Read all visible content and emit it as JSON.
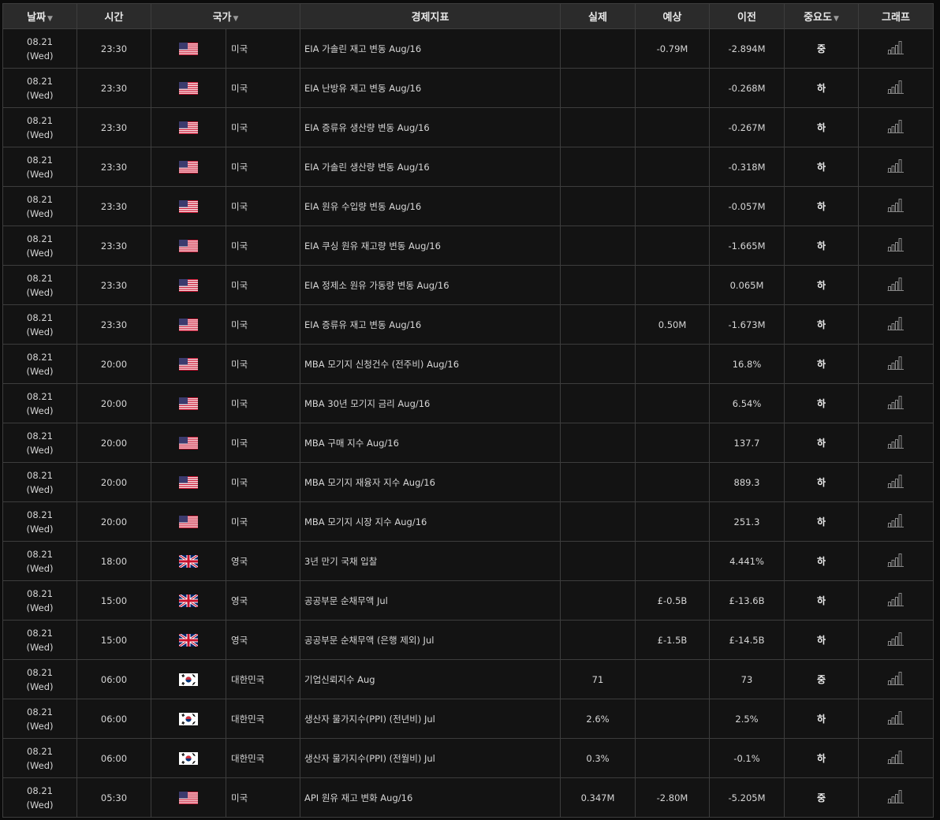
{
  "headers": {
    "date": "날짜",
    "time": "시간",
    "country": "국가",
    "indicator": "경제지표",
    "actual": "실제",
    "forecast": "예상",
    "previous": "이전",
    "importance": "중요도",
    "graph": "그래프",
    "sort_arrow": "▼"
  },
  "icons": {
    "sort": "triangle-down-icon",
    "graph": "bar-chart-icon",
    "flags": {
      "US": "us-flag-icon",
      "UK": "uk-flag-icon",
      "KR": "kr-flag-icon"
    }
  },
  "colors": {
    "background": "#0c0c0c",
    "header_bg": "#2b2b2b",
    "row_bg": "#131313",
    "border": "#3d3d3d"
  },
  "rows": [
    {
      "date": "08.21",
      "day": "(Wed)",
      "time": "23:30",
      "flag": "US",
      "country": "미국",
      "indicator": "EIA 가솔린 재고 변동 Aug/16",
      "actual": "",
      "forecast": "-0.79M",
      "previous": "-2.894M",
      "importance": "중"
    },
    {
      "date": "08.21",
      "day": "(Wed)",
      "time": "23:30",
      "flag": "US",
      "country": "미국",
      "indicator": "EIA 난방유 재고 변동 Aug/16",
      "actual": "",
      "forecast": "",
      "previous": "-0.268M",
      "importance": "하"
    },
    {
      "date": "08.21",
      "day": "(Wed)",
      "time": "23:30",
      "flag": "US",
      "country": "미국",
      "indicator": "EIA 증류유 생산량 변동 Aug/16",
      "actual": "",
      "forecast": "",
      "previous": "-0.267M",
      "importance": "하"
    },
    {
      "date": "08.21",
      "day": "(Wed)",
      "time": "23:30",
      "flag": "US",
      "country": "미국",
      "indicator": "EIA 가솔린 생산량 변동 Aug/16",
      "actual": "",
      "forecast": "",
      "previous": "-0.318M",
      "importance": "하"
    },
    {
      "date": "08.21",
      "day": "(Wed)",
      "time": "23:30",
      "flag": "US",
      "country": "미국",
      "indicator": "EIA 원유 수입량 변동 Aug/16",
      "actual": "",
      "forecast": "",
      "previous": "-0.057M",
      "importance": "하"
    },
    {
      "date": "08.21",
      "day": "(Wed)",
      "time": "23:30",
      "flag": "US",
      "country": "미국",
      "indicator": "EIA 쿠싱 원유 재고량 변동 Aug/16",
      "actual": "",
      "forecast": "",
      "previous": "-1.665M",
      "importance": "하"
    },
    {
      "date": "08.21",
      "day": "(Wed)",
      "time": "23:30",
      "flag": "US",
      "country": "미국",
      "indicator": "EIA 정제소 원유 가동량 변동 Aug/16",
      "actual": "",
      "forecast": "",
      "previous": "0.065M",
      "importance": "하"
    },
    {
      "date": "08.21",
      "day": "(Wed)",
      "time": "23:30",
      "flag": "US",
      "country": "미국",
      "indicator": "EIA 증류유 재고 변동 Aug/16",
      "actual": "",
      "forecast": "0.50M",
      "previous": "-1.673M",
      "importance": "하"
    },
    {
      "date": "08.21",
      "day": "(Wed)",
      "time": "20:00",
      "flag": "US",
      "country": "미국",
      "indicator": "MBA 모기지 신청건수 (전주비) Aug/16",
      "actual": "",
      "forecast": "",
      "previous": "16.8%",
      "importance": "하"
    },
    {
      "date": "08.21",
      "day": "(Wed)",
      "time": "20:00",
      "flag": "US",
      "country": "미국",
      "indicator": "MBA 30년 모기지 금리 Aug/16",
      "actual": "",
      "forecast": "",
      "previous": "6.54%",
      "importance": "하"
    },
    {
      "date": "08.21",
      "day": "(Wed)",
      "time": "20:00",
      "flag": "US",
      "country": "미국",
      "indicator": "MBA 구매 지수 Aug/16",
      "actual": "",
      "forecast": "",
      "previous": "137.7",
      "importance": "하"
    },
    {
      "date": "08.21",
      "day": "(Wed)",
      "time": "20:00",
      "flag": "US",
      "country": "미국",
      "indicator": "MBA 모기지 재융자 지수 Aug/16",
      "actual": "",
      "forecast": "",
      "previous": "889.3",
      "importance": "하"
    },
    {
      "date": "08.21",
      "day": "(Wed)",
      "time": "20:00",
      "flag": "US",
      "country": "미국",
      "indicator": "MBA 모기지 시장 지수 Aug/16",
      "actual": "",
      "forecast": "",
      "previous": "251.3",
      "importance": "하"
    },
    {
      "date": "08.21",
      "day": "(Wed)",
      "time": "18:00",
      "flag": "UK",
      "country": "영국",
      "indicator": "3년 만기 국채 입찰",
      "actual": "",
      "forecast": "",
      "previous": "4.441%",
      "importance": "하"
    },
    {
      "date": "08.21",
      "day": "(Wed)",
      "time": "15:00",
      "flag": "UK",
      "country": "영국",
      "indicator": "공공부문 순채무액 Jul",
      "actual": "",
      "forecast": "£-0.5B",
      "previous": "£-13.6B",
      "importance": "하"
    },
    {
      "date": "08.21",
      "day": "(Wed)",
      "time": "15:00",
      "flag": "UK",
      "country": "영국",
      "indicator": "공공부문 순채무액 (은행 제외) Jul",
      "actual": "",
      "forecast": "£-1.5B",
      "previous": "£-14.5B",
      "importance": "하"
    },
    {
      "date": "08.21",
      "day": "(Wed)",
      "time": "06:00",
      "flag": "KR",
      "country": "대한민국",
      "indicator": "기업신뢰지수 Aug",
      "actual": "71",
      "forecast": "",
      "previous": "73",
      "importance": "중"
    },
    {
      "date": "08.21",
      "day": "(Wed)",
      "time": "06:00",
      "flag": "KR",
      "country": "대한민국",
      "indicator": "생산자 물가지수(PPI) (전년비) Jul",
      "actual": "2.6%",
      "forecast": "",
      "previous": "2.5%",
      "importance": "하"
    },
    {
      "date": "08.21",
      "day": "(Wed)",
      "time": "06:00",
      "flag": "KR",
      "country": "대한민국",
      "indicator": "생산자 물가지수(PPI) (전월비) Jul",
      "actual": "0.3%",
      "forecast": "",
      "previous": "-0.1%",
      "importance": "하"
    },
    {
      "date": "08.21",
      "day": "(Wed)",
      "time": "05:30",
      "flag": "US",
      "country": "미국",
      "indicator": "API 원유 재고 변화 Aug/16",
      "actual": "0.347M",
      "forecast": "-2.80M",
      "previous": "-5.205M",
      "importance": "중"
    }
  ]
}
